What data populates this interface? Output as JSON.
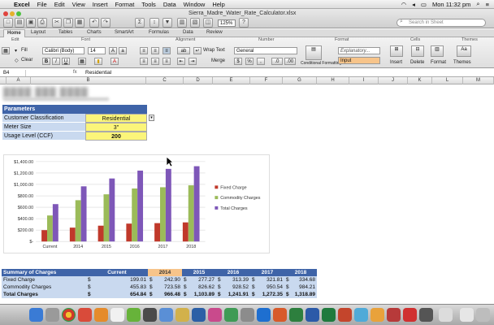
{
  "menubar": {
    "app": "Excel",
    "items": [
      "File",
      "Edit",
      "View",
      "Insert",
      "Format",
      "Tools",
      "Data",
      "Window",
      "Help"
    ],
    "clock": "Mon 11:32 pm"
  },
  "window": {
    "title": "Sierra_Madre_Water_Rate_Calculator.xlsx",
    "zoom": "125%",
    "search_placeholder": "Search in Sheet"
  },
  "ribbon": {
    "tabs": [
      "Home",
      "Layout",
      "Tables",
      "Charts",
      "SmartArt",
      "Formulas",
      "Data",
      "Review"
    ],
    "groups": [
      "Edit",
      "Font",
      "Alignment",
      "Number",
      "Format",
      "Cells",
      "Themes"
    ],
    "fill_label": "Fill",
    "clear_label": "Clear",
    "font_name": "Calibri (Body)",
    "font_size": "14",
    "wrap_text_label": "Wrap Text",
    "merge_label": "Merge",
    "number_format": "General",
    "conditional_formatting_label": "Conditional Formatting",
    "style_explanatory": "Explanatory...",
    "style_input": "Input",
    "insert_label": "Insert",
    "delete_label": "Delete",
    "format_label": "Format",
    "themes_label": "Themes"
  },
  "formula_bar": {
    "name_box": "B4",
    "fx": "fx",
    "formula": "Residential"
  },
  "columns": [
    "A",
    "B",
    "C",
    "D",
    "E",
    "F",
    "G",
    "H",
    "I",
    "J",
    "K",
    "L",
    "M"
  ],
  "parameters": {
    "header": "Parameters",
    "rows": [
      {
        "label": "Customer Classification",
        "value": "Residential"
      },
      {
        "label": "Meter Size",
        "value": "3\""
      },
      {
        "label": "Usage Level (CCF)",
        "value": "200"
      }
    ]
  },
  "summary": {
    "header": "Summary of Charges",
    "columns": [
      "Current",
      "2014",
      "2015",
      "2016",
      "2017",
      "2018"
    ],
    "currency": "$",
    "rows": [
      {
        "label": "Fixed Charge",
        "values": [
          "199.01",
          "242.90",
          "277.27",
          "313.39",
          "321.81",
          "334.68"
        ]
      },
      {
        "label": "Commodity Charges",
        "values": [
          "455.83",
          "723.58",
          "826.62",
          "928.52",
          "950.54",
          "984.21"
        ]
      },
      {
        "label": "Total Charges",
        "values": [
          "654.84",
          "966.48",
          "1,103.89",
          "1,241.91",
          "1,272.35",
          "1,318.89"
        ]
      }
    ]
  },
  "chart_data": {
    "type": "bar",
    "categories": [
      "Current",
      "2014",
      "2015",
      "2016",
      "2017",
      "2018"
    ],
    "series": [
      {
        "name": "Fixed Charge",
        "color": "#c0392b",
        "values": [
          199.01,
          242.9,
          277.27,
          313.39,
          321.81,
          334.68
        ]
      },
      {
        "name": "Commodity Charges",
        "color": "#9bbb59",
        "values": [
          455.83,
          723.58,
          826.62,
          928.52,
          950.54,
          984.21
        ]
      },
      {
        "name": "Total Charges",
        "color": "#7e57b8",
        "values": [
          654.84,
          966.48,
          1103.89,
          1241.91,
          1272.35,
          1318.89
        ]
      }
    ],
    "ylim": [
      0,
      1400
    ],
    "yticks": [
      "$-",
      "$200.00",
      "$400.00",
      "$600.00",
      "$800.00",
      "$1,000.00",
      "$1,200.00",
      "$1,400.00"
    ],
    "legend_position": "right",
    "grid": true
  }
}
